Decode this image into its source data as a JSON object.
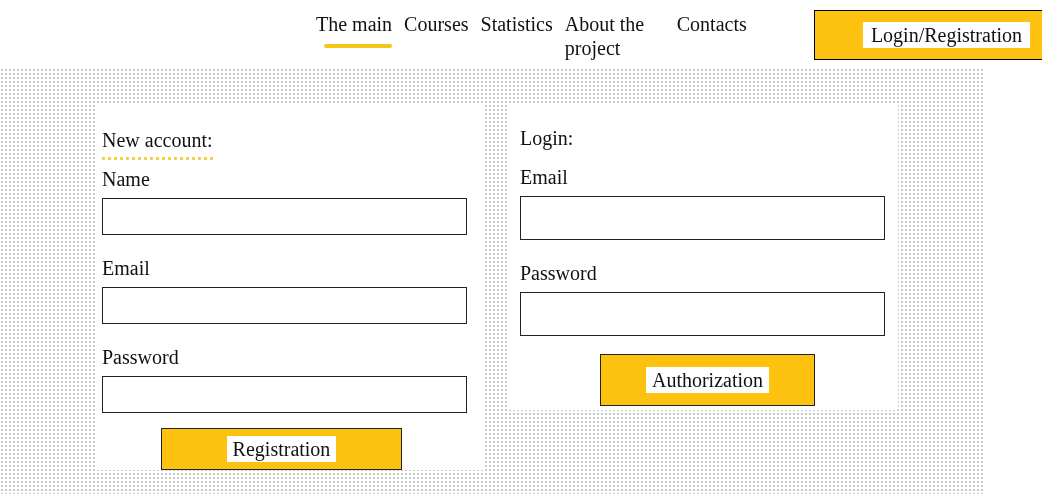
{
  "nav": {
    "items": [
      {
        "label": "The main",
        "selected": true
      },
      {
        "label": "Courses",
        "selected": false
      },
      {
        "label": "Statistics",
        "selected": false
      },
      {
        "label": "About the project",
        "selected": false
      },
      {
        "label": "Contacts",
        "selected": false
      }
    ],
    "login_button": "Login/Registration"
  },
  "forms": [
    {
      "heading": "New account:",
      "underlined": true,
      "fields": [
        {
          "label": "Name"
        },
        {
          "label": "Email"
        },
        {
          "label": "Password"
        }
      ],
      "button": "Registration"
    },
    {
      "heading": "Login:",
      "underlined": false,
      "fields": [
        {
          "label": "Email"
        },
        {
          "label": "Password"
        }
      ],
      "button": "Authorization"
    }
  ]
}
